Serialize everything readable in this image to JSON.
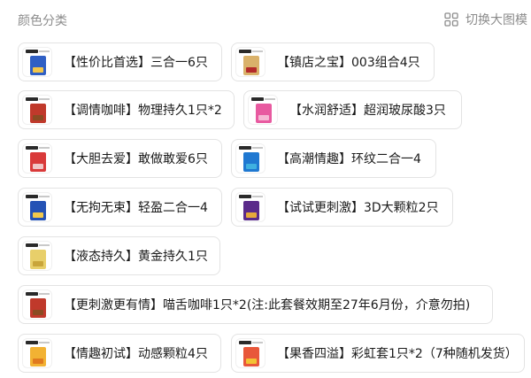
{
  "header": {
    "title": "颜色分类",
    "switch_label": "切换大图模"
  },
  "options": [
    {
      "label": "【性价比首选】三合一6只",
      "thumb_colors": [
        "#ffffff",
        "#2f5fc4",
        "#f3c64a"
      ]
    },
    {
      "label": "【镇店之宝】003组合4只",
      "thumb_colors": [
        "#ffffff",
        "#d9b16a",
        "#b42a2a"
      ]
    },
    {
      "label": "【调情咖啡】物理持久1只*2",
      "thumb_colors": [
        "#ffffff",
        "#c0392b",
        "#8a4b22"
      ]
    },
    {
      "label": "【水润舒适】超润玻尿酸3只",
      "thumb_colors": [
        "#ffffff",
        "#e85aa0",
        "#f6b8d4"
      ]
    },
    {
      "label": "【大胆去爱】敢做敢爱6只",
      "thumb_colors": [
        "#ffffff",
        "#d93a3a",
        "#f0c6c6"
      ]
    },
    {
      "label": "【高潮情趣】环纹二合一4",
      "thumb_colors": [
        "#ffffff",
        "#1f78d1",
        "#3fb0e0"
      ]
    },
    {
      "label": "【无拘无束】轻盈二合一4",
      "thumb_colors": [
        "#ffffff",
        "#2452b5",
        "#f2c94c"
      ]
    },
    {
      "label": "【试试更刺激】3D大颗粒2只",
      "thumb_colors": [
        "#ffffff",
        "#5a2a8a",
        "#e6a93a"
      ]
    },
    {
      "label": "【液态持久】黄金持久1只",
      "thumb_colors": [
        "#ffffff",
        "#e8cf6a",
        "#c9a53a"
      ]
    },
    {
      "label": "【更刺激更有情】喵舌咖啡1只*2(注:此套餐效期至27年6月份，介意勿拍)",
      "thumb_colors": [
        "#ffffff",
        "#c0392b",
        "#8a4b22"
      ]
    },
    {
      "label": "【情趣初试】动感颗粒4只",
      "thumb_colors": [
        "#ffffff",
        "#f2b233",
        "#e07a1f"
      ]
    },
    {
      "label": "【果香四溢】彩虹套1只*2（7种随机发货）",
      "thumb_colors": [
        "#ffffff",
        "#e8573a",
        "#f2c233"
      ]
    }
  ]
}
